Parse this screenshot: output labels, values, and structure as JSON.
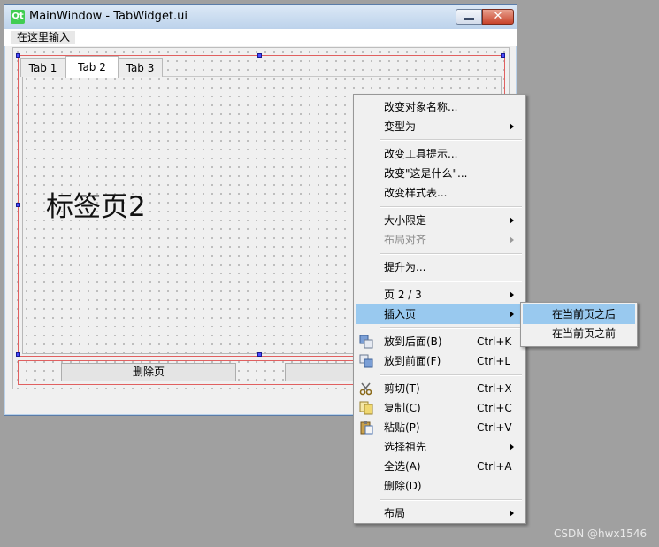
{
  "window": {
    "app_icon": "Qt",
    "title": "MainWindow - TabWidget.ui",
    "close_glyph": "✕"
  },
  "menubar": {
    "placeholder": "在这里输入"
  },
  "tabs": [
    {
      "label": "Tab 1",
      "selected": false
    },
    {
      "label": "Tab 2",
      "selected": true
    },
    {
      "label": "Tab 3",
      "selected": false
    }
  ],
  "tab_page": {
    "label": "标签页2"
  },
  "buttons": {
    "delete_page": "删除页"
  },
  "context_menu": {
    "items": [
      {
        "label": "改变对象名称..."
      },
      {
        "label": "变型为",
        "submenu": true
      },
      {
        "label": "改变工具提示..."
      },
      {
        "label": "改变\"这是什么\"..."
      },
      {
        "label": "改变样式表..."
      },
      {
        "label": "大小限定",
        "submenu": true
      },
      {
        "label": "布局对齐",
        "submenu": true,
        "disabled": true
      },
      {
        "label": "提升为..."
      },
      {
        "label": "页 2 / 3",
        "submenu": true
      },
      {
        "label": "插入页",
        "submenu": true,
        "highlighted": true
      },
      {
        "label": "放到后面(B)",
        "shortcut": "Ctrl+K",
        "icon": "send-to-back-icon"
      },
      {
        "label": "放到前面(F)",
        "shortcut": "Ctrl+L",
        "icon": "bring-to-front-icon"
      },
      {
        "label": "剪切(T)",
        "shortcut": "Ctrl+X",
        "icon": "scissors-icon"
      },
      {
        "label": "复制(C)",
        "shortcut": "Ctrl+C",
        "icon": "copy-icon"
      },
      {
        "label": "粘贴(P)",
        "shortcut": "Ctrl+V",
        "icon": "paste-icon"
      },
      {
        "label": "选择祖先",
        "submenu": true
      },
      {
        "label": "全选(A)",
        "shortcut": "Ctrl+A"
      },
      {
        "label": "删除(D)"
      },
      {
        "label": "布局",
        "submenu": true
      }
    ]
  },
  "submenu": {
    "items": [
      {
        "label": "在当前页之后",
        "highlighted": true
      },
      {
        "label": "在当前页之前",
        "highlighted": false
      }
    ]
  },
  "watermark": "CSDN @hwx1546",
  "colors": {
    "highlight": "#99c9ef",
    "selection_frame": "#e06060",
    "handle": "#4a4aff"
  }
}
